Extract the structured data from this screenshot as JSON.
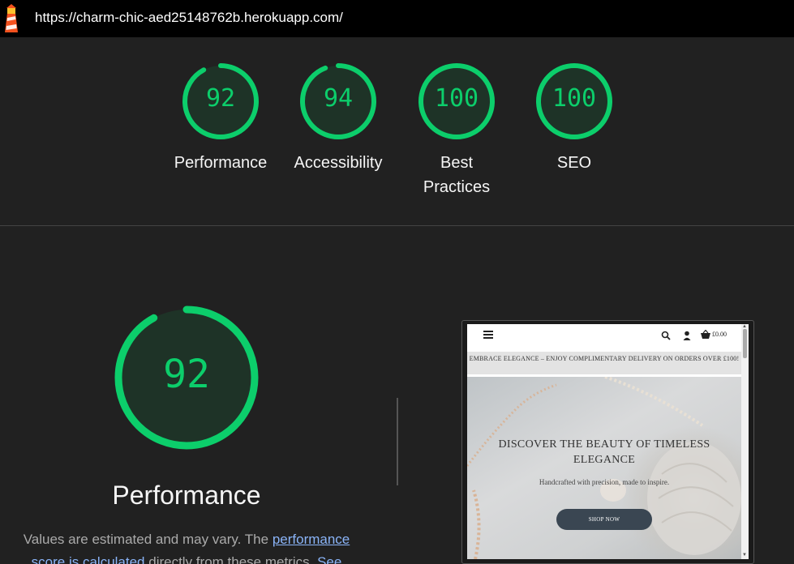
{
  "address_bar": {
    "url": "https://charm-chic-aed25148762b.herokuapp.com/"
  },
  "summary": [
    {
      "score": "92",
      "label": "Performance",
      "fraction": 0.92
    },
    {
      "score": "94",
      "label": "Accessibility",
      "fraction": 0.94
    },
    {
      "score": "100",
      "label": "Best Practices",
      "fraction": 1.0
    },
    {
      "score": "100",
      "label": "SEO",
      "fraction": 1.0
    }
  ],
  "performance": {
    "score": "92",
    "fraction": 0.92,
    "title": "Performance",
    "desc_start": "Values are estimated and may vary. The ",
    "link1": "performance score is calculated",
    "desc_mid": " directly from these metrics. ",
    "link2": "See"
  },
  "preview": {
    "cart_total": "£0.00",
    "banner": "EMBRACE ELEGANCE – ENJOY COMPLIMENTARY DELIVERY ON ORDERS OVER £100!",
    "headline": "DISCOVER THE BEAUTY OF TIMELESS ELEGANCE",
    "subheading": "Handcrafted with precision, made to inspire.",
    "cta": "SHOP NOW"
  },
  "colors": {
    "pass": "#0cce6b",
    "gauge_bg": "#1e3327",
    "link": "#8ab4f8"
  }
}
